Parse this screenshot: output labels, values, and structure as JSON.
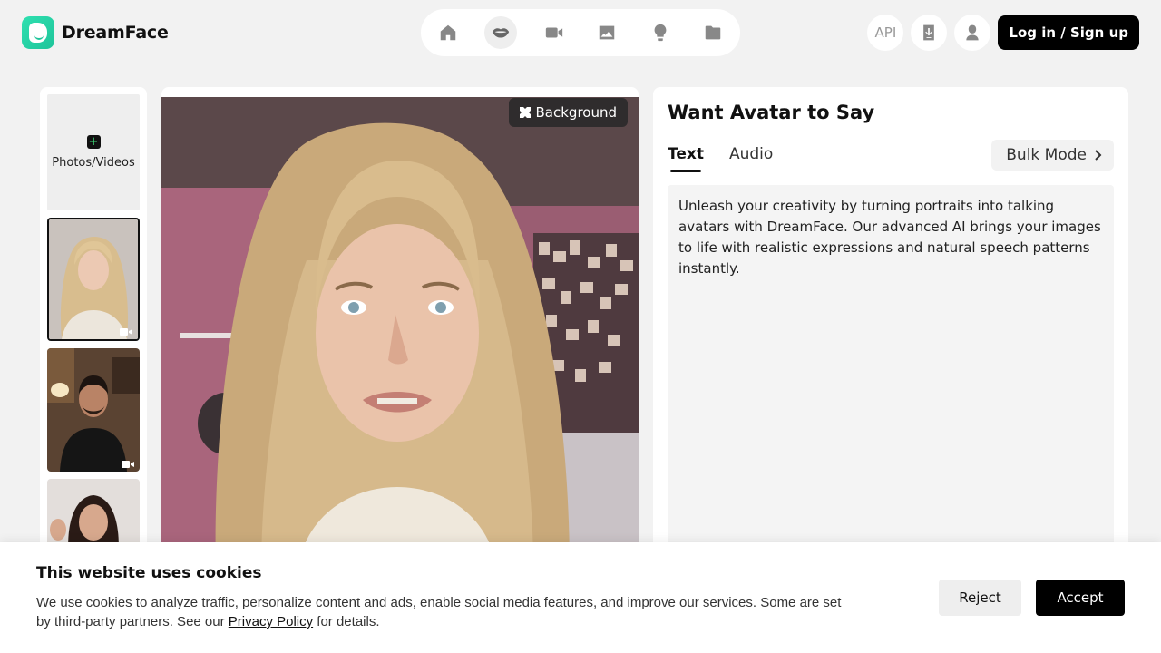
{
  "header": {
    "logo_text": "DreamFace",
    "nav": [
      {
        "icon": "home-icon",
        "active": false
      },
      {
        "icon": "lips-icon",
        "active": true
      },
      {
        "icon": "video-camera-icon",
        "active": false
      },
      {
        "icon": "image-icon",
        "active": false
      },
      {
        "icon": "lightbulb-icon",
        "active": false
      },
      {
        "icon": "folder-icon",
        "active": false
      }
    ],
    "api_label": "API",
    "login_label": "Log in / Sign up"
  },
  "sidebar": {
    "upload_label": "Photos/Videos",
    "thumbnails": [
      {
        "name": "blonde-woman",
        "selected": true,
        "is_video": true
      },
      {
        "name": "man-black-shirt",
        "selected": false,
        "is_video": true
      },
      {
        "name": "dark-hair-woman",
        "selected": false,
        "is_video": false
      }
    ]
  },
  "preview": {
    "background_label": "Background"
  },
  "editor": {
    "title": "Want Avatar to Say",
    "tabs": [
      "Text",
      "Audio"
    ],
    "active_tab": "Text",
    "bulk_label": "Bulk Mode",
    "text_value": "Unleash your creativity by turning portraits into talking avatars with DreamFace. Our advanced AI brings your images to life with realistic expressions and natural speech patterns instantly."
  },
  "cookie": {
    "title": "This website uses cookies",
    "text_before": "We use cookies to analyze traffic, personalize content and ads, enable social media features, and improve our services. Some are set by third-party partners. See our ",
    "link_text": "Privacy Policy",
    "text_after": " for details.",
    "reject_label": "Reject",
    "accept_label": "Accept"
  },
  "colors": {
    "brand": "#1ec49a",
    "background": "#f2f2f2",
    "primary_button": "#000000"
  }
}
